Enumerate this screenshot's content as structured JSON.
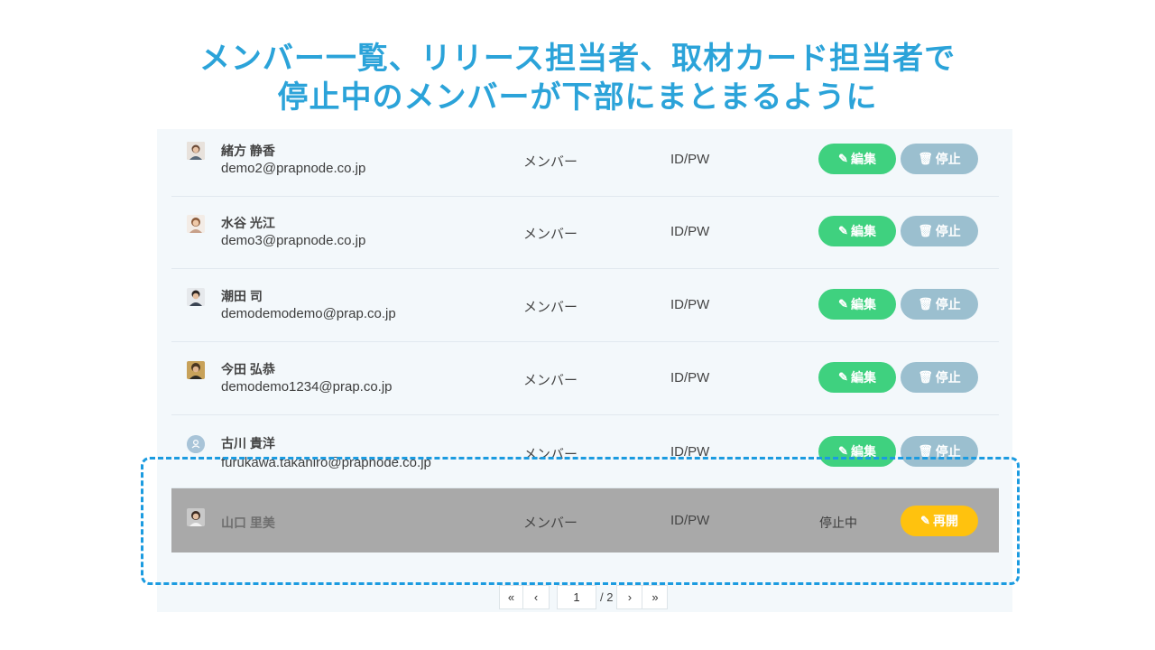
{
  "title": {
    "line1": "メンバー一覧、リリース担当者、取材カード担当者で",
    "line2": "停止中のメンバーが下部にまとまるように"
  },
  "members": [
    {
      "name": "緒方 静香",
      "email": "demo2@prapnode.co.jp",
      "role": "メンバー",
      "auth": "ID/PW",
      "edit_label": "編集",
      "stop_label": "停止"
    },
    {
      "name": "水谷 光江",
      "email": "demo3@prapnode.co.jp",
      "role": "メンバー",
      "auth": "ID/PW",
      "edit_label": "編集",
      "stop_label": "停止"
    },
    {
      "name": "潮田 司",
      "email": "demodemodemo@prap.co.jp",
      "role": "メンバー",
      "auth": "ID/PW",
      "edit_label": "編集",
      "stop_label": "停止"
    },
    {
      "name": "今田 弘恭",
      "email": "demodemo1234@prap.co.jp",
      "role": "メンバー",
      "auth": "ID/PW",
      "edit_label": "編集",
      "stop_label": "停止"
    },
    {
      "name": "古川 貴洋",
      "email": "furukawa.takahiro@prapnode.co.jp",
      "role": "メンバー",
      "auth": "ID/PW",
      "edit_label": "編集",
      "stop_label": "停止"
    }
  ],
  "suspended_member": {
    "name": "山口 里美",
    "role": "メンバー",
    "auth": "ID/PW",
    "status": "停止中",
    "resume_label": "再開"
  },
  "pagination": {
    "first": "«",
    "prev": "‹",
    "current_page": "1",
    "total": "/ 2",
    "next": "›",
    "last": "»"
  },
  "colors": {
    "title": "#2ba3d9",
    "edit": "#3fd17f",
    "stop": "#9bbfcf",
    "resume": "#ffc20e",
    "suspended_row": "#a9a9a9",
    "highlight_border": "#1b9be0"
  },
  "icons": {
    "edit": "pencil-icon",
    "stop": "trash-icon",
    "resume": "pencil-icon"
  }
}
